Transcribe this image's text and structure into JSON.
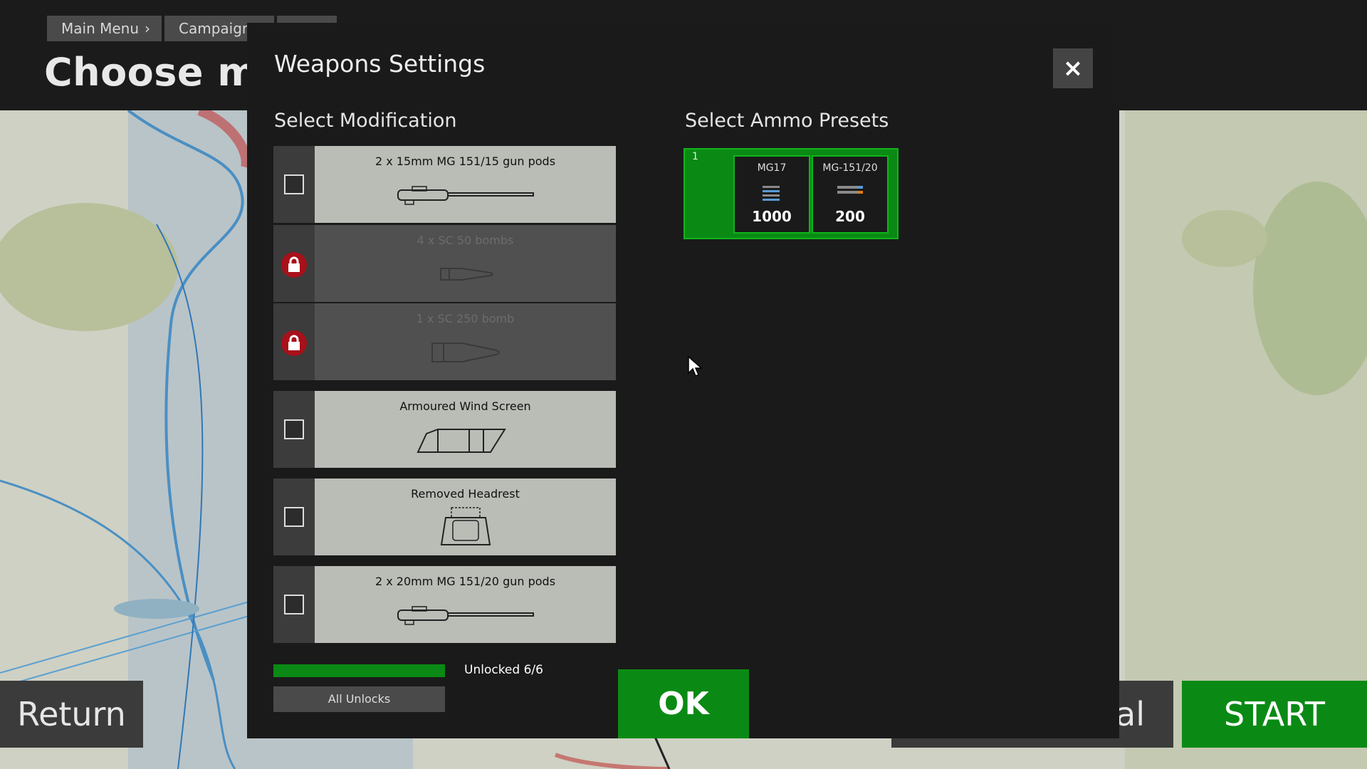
{
  "breadcrumb": [
    "Main Menu",
    "Campaign",
    ""
  ],
  "page_title": "Choose miss",
  "bottom_bar": {
    "return_label": "Return",
    "final_label": "al",
    "start_label": "START"
  },
  "modal": {
    "title": "Weapons Settings",
    "close_symbol": "×",
    "modification_title": "Select Modification",
    "ammo_title": "Select Ammo Presets",
    "modifications": [
      {
        "label": "2 x 15mm MG 151/15 gun pods",
        "locked": false,
        "icon": "gun-pod-icon"
      },
      {
        "label": "4 x SC 50 bombs",
        "locked": true,
        "icon": "bomb-icon"
      },
      {
        "label": "1 x SC 250 bomb",
        "locked": true,
        "icon": "bomb-icon"
      },
      {
        "label": "Armoured Wind Screen",
        "locked": false,
        "icon": "windscreen-icon"
      },
      {
        "label": "Removed Headrest",
        "locked": false,
        "icon": "headrest-icon"
      },
      {
        "label": "2 x 20mm MG 151/20 gun pods",
        "locked": false,
        "icon": "gun-pod-icon"
      }
    ],
    "unlock_progress": 1.0,
    "unlock_text": "Unlocked 6/6",
    "all_unlocks_label": "All Unlocks",
    "ok_label": "OK",
    "preset": {
      "number": "1",
      "slots": [
        {
          "name": "MG17",
          "count": "1000"
        },
        {
          "name": "MG-151/20",
          "count": "200"
        }
      ]
    }
  },
  "colors": {
    "accent_green": "#0a8a14",
    "lock_red": "#a8101a"
  }
}
